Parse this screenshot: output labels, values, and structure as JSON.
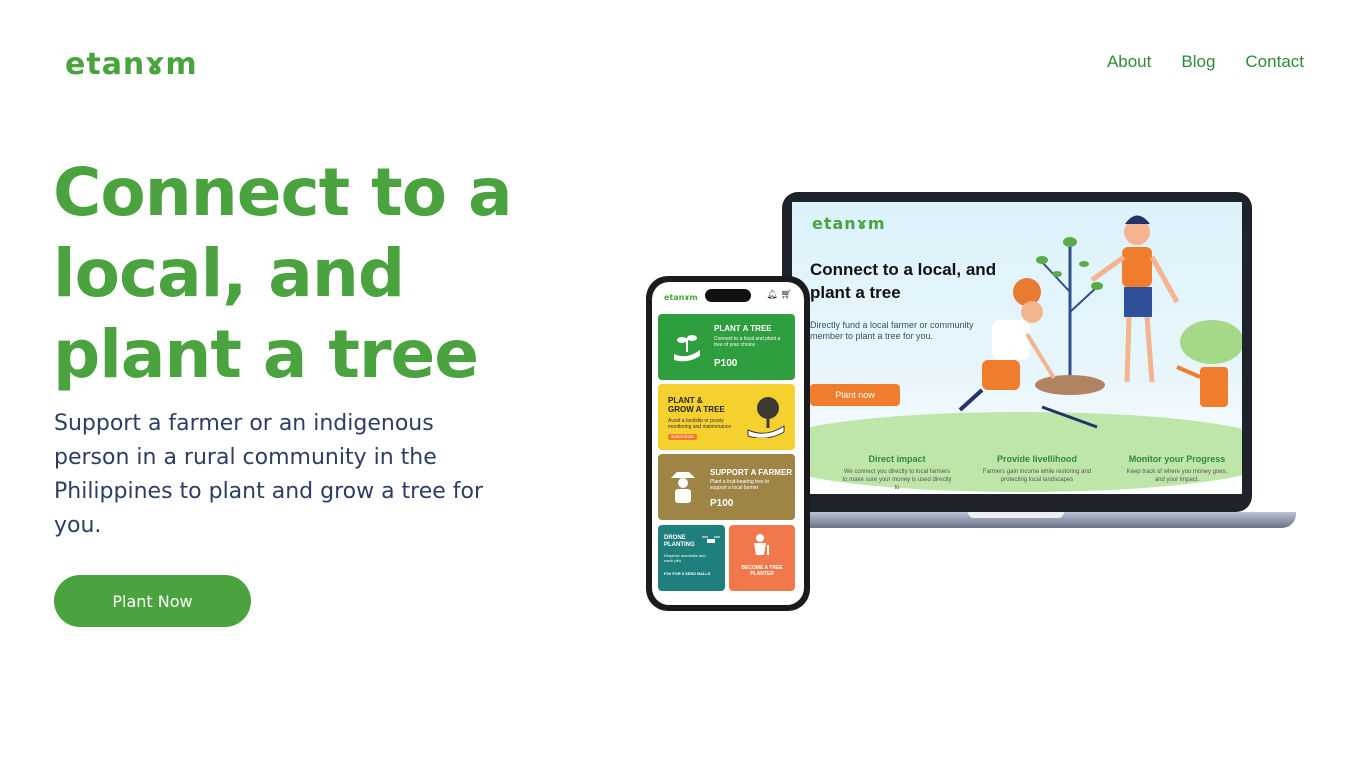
{
  "brand": {
    "logo_text": "etanɤm",
    "primary_color": "#4aa33f",
    "text_color": "#2c3e63"
  },
  "nav": {
    "items": [
      {
        "label": "About"
      },
      {
        "label": "Blog"
      },
      {
        "label": "Contact"
      }
    ]
  },
  "hero": {
    "title": "Connect to a local, and plant a tree",
    "subtitle": "Support a farmer or an indigenous person in a rural community in the Philippines to plant and grow a tree for you.",
    "cta_label": "Plant Now"
  },
  "laptop_mockup": {
    "logo_text": "etanɤm",
    "title": "Connect to a local, and plant a tree",
    "description": "Directly fund a local farmer or community member to plant a tree for you.",
    "button_label": "Plant now",
    "features": [
      {
        "title": "Direct impact",
        "desc": "We connect you directly to local farmers to make sure your money is used directly to"
      },
      {
        "title": "Provide livellihood",
        "desc": "Farmers gain income while restoring and protecting local landscapes"
      },
      {
        "title": "Monitor your Progress",
        "desc": "Keep track of where you money goes, and your impact."
      }
    ]
  },
  "phone_mockup": {
    "logo_text": "etanɤm",
    "cards": [
      {
        "title": "PLANT A TREE",
        "desc": "Connect to a local and plant a tree of your choice",
        "price": "P100",
        "color": "#2f9e3f"
      },
      {
        "title": "PLANT & GROW A TREE",
        "desc": "Avoid a landslip or poorly monitoring and maintenance",
        "badge": "SUBSCRIBE",
        "color": "#f5d130"
      },
      {
        "title": "SUPPORT A FARMER",
        "desc": "Plant a fruit-bearing tree to support a local farmer",
        "price": "P100",
        "color": "#9e8546"
      },
      {
        "title": "DRONE PLANTING",
        "desc": "Disperse seedballs and earth pills",
        "price": "P20 FOR 5 SEED BALLS",
        "color": "#1e7f7c"
      },
      {
        "title": "BECOME A TREE PLANTER",
        "color": "#f0784a"
      }
    ]
  }
}
